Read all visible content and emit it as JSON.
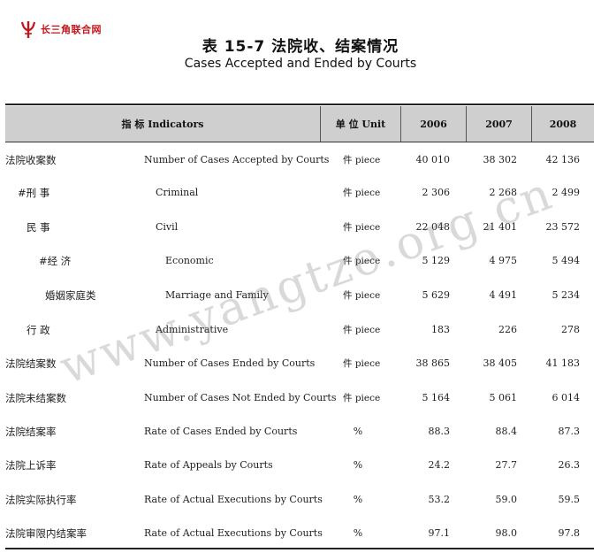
{
  "logo": {
    "text": "长三角联合网",
    "mark_color": "#c0161b"
  },
  "title": {
    "cn": "表 15-7   法院收、结案情况",
    "en": "Cases Accepted and Ended by Courts"
  },
  "header": {
    "indicators": "指   标   Indicators",
    "unit": "单   位   Unit",
    "years": [
      "2006",
      "2007",
      "2008"
    ]
  },
  "rows": [
    {
      "cn": "法院收案数",
      "en": "Number of Cases Accepted by Courts",
      "unit": "件 piece",
      "values": [
        "40 010",
        "38 302",
        "42 136"
      ]
    },
    {
      "cn": "#刑   事",
      "en": "Criminal",
      "unit": "件 piece",
      "values": [
        "2 306",
        "2 268",
        "2 499"
      ]
    },
    {
      "cn": "民   事",
      "en": "Civil",
      "unit": "件 piece",
      "values": [
        "22 048",
        "21 401",
        "23 572"
      ]
    },
    {
      "cn": "#经   济",
      "en": "Economic",
      "unit": "件 piece",
      "values": [
        "5 129",
        "4 975",
        "5 494"
      ]
    },
    {
      "cn": "婚姻家庭类",
      "en": "Marriage and Family",
      "unit": "件 piece",
      "values": [
        "5 629",
        "4 491",
        "5 234"
      ]
    },
    {
      "cn": "行   政",
      "en": "Administrative",
      "unit": "件 piece",
      "values": [
        "183",
        "226",
        "278"
      ]
    },
    {
      "cn": "法院结案数",
      "en": "Number of Cases Ended by Courts",
      "unit": "件 piece",
      "values": [
        "38 865",
        "38 405",
        "41 183"
      ]
    },
    {
      "cn": "法院未结案数",
      "en": "Number of Cases Not Ended by Courts",
      "unit": "件 piece",
      "values": [
        "5 164",
        "5 061",
        "6 014"
      ]
    },
    {
      "cn": "法院结案率",
      "en": "Rate of Cases Ended by Courts",
      "unit": "%",
      "values": [
        "88.3",
        "88.4",
        "87.3"
      ]
    },
    {
      "cn": "法院上诉率",
      "en": "Rate of Appeals by Courts",
      "unit": "%",
      "values": [
        "24.2",
        "27.7",
        "26.3"
      ]
    },
    {
      "cn": "法院实际执行率",
      "en": "Rate of Actual Executions by Courts",
      "unit": "%",
      "values": [
        "53.2",
        "59.0",
        "59.5"
      ]
    },
    {
      "cn": "法院审限内结案率",
      "en": "Rate of Actual Executions by Courts",
      "unit": "%",
      "values": [
        "97.1",
        "98.0",
        "97.8"
      ]
    }
  ],
  "watermark": "www.yangtze.org.cn"
}
